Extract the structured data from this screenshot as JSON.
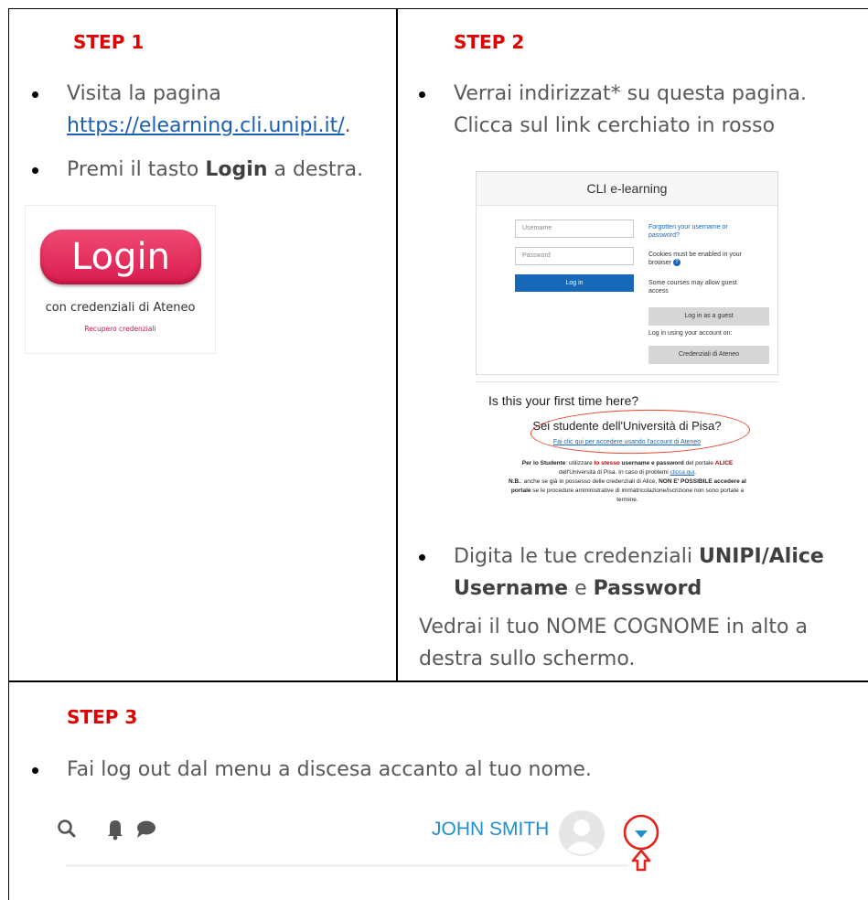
{
  "step1": {
    "heading": "STEP 1",
    "bullet1_text": "Visita la pagina",
    "bullet1_link": "https://elearning.cli.unipi.it/",
    "bullet1_suffix": ".",
    "bullet2_pre": "Premi il tasto ",
    "bullet2_bold": "Login",
    "bullet2_post": " a destra.",
    "login_button": "Login",
    "login_subtitle": "con credenziali di Ateneo",
    "login_recover": "Recupero credenziali"
  },
  "step2": {
    "heading": "STEP 2",
    "bullet1_line1": "Verrai indirizzat* su questa pagina.",
    "bullet1_line2": "Clicca sul link cerchiato in rosso",
    "cli": {
      "title": "CLI e-learning",
      "username_placeholder": "Username",
      "password_placeholder": "Password",
      "login_button": "Log in",
      "forgot_link": "Forgotten your username or password?",
      "cookies_text": "Cookies must be enabled in your browser",
      "guest_note": "Some courses may allow guest access",
      "guest_button": "Log in as a guest",
      "account_note": "Log in using your account on:",
      "ateneo_button": "Credenziali di Ateneo"
    },
    "first_time": {
      "title": "Is this your first time here?",
      "question": "Sei studente dell'Università di Pisa?",
      "link": "Fai clic qui per accedere usando l'account di Ateneo",
      "p1_a": "Per lo Studente",
      "p1_b": ": utilizzare ",
      "p1_c": "lo stesso",
      "p1_d": " username e password",
      "p1_e": " del portale ",
      "p1_f": "ALICE",
      "p2_a": "dell'Università di Pisa. In caso di problemi ",
      "p2_link": "clicca qui",
      "p3_a": "N.B.",
      "p3_b": ": anche se già in possesso delle credenziali di Alice, ",
      "p3_c": "NON E' POSSIBILE accedere al",
      "p4_a": "portale",
      "p4_b": " se le procedure amministrative di immatricolazione/iscrizione non sono portate a",
      "p5": "termine."
    },
    "bullet2_pre": "Digita le tue credenziali ",
    "bullet2_bold1": "UNIPI/Alice",
    "bullet2_bold2": "Username",
    "bullet2_mid": " e ",
    "bullet2_bold3": "Password",
    "note_line1": "Vedrai il tuo NOME COGNOME in alto a",
    "note_line2": "destra sullo schermo."
  },
  "step3": {
    "heading": "STEP 3",
    "bullet": "Fai log out dal menu a discesa accanto al tuo nome.",
    "user_name": "JOHN SMITH"
  },
  "colors": {
    "heading_red": "#e00000",
    "link_blue": "#1a5fb4",
    "username_blue": "#1f8fd1",
    "annotation_red": "#e2231a"
  },
  "icons": [
    "search-icon",
    "bell-icon",
    "chat-icon",
    "avatar-icon",
    "dropdown-caret-icon",
    "up-arrow-icon"
  ]
}
